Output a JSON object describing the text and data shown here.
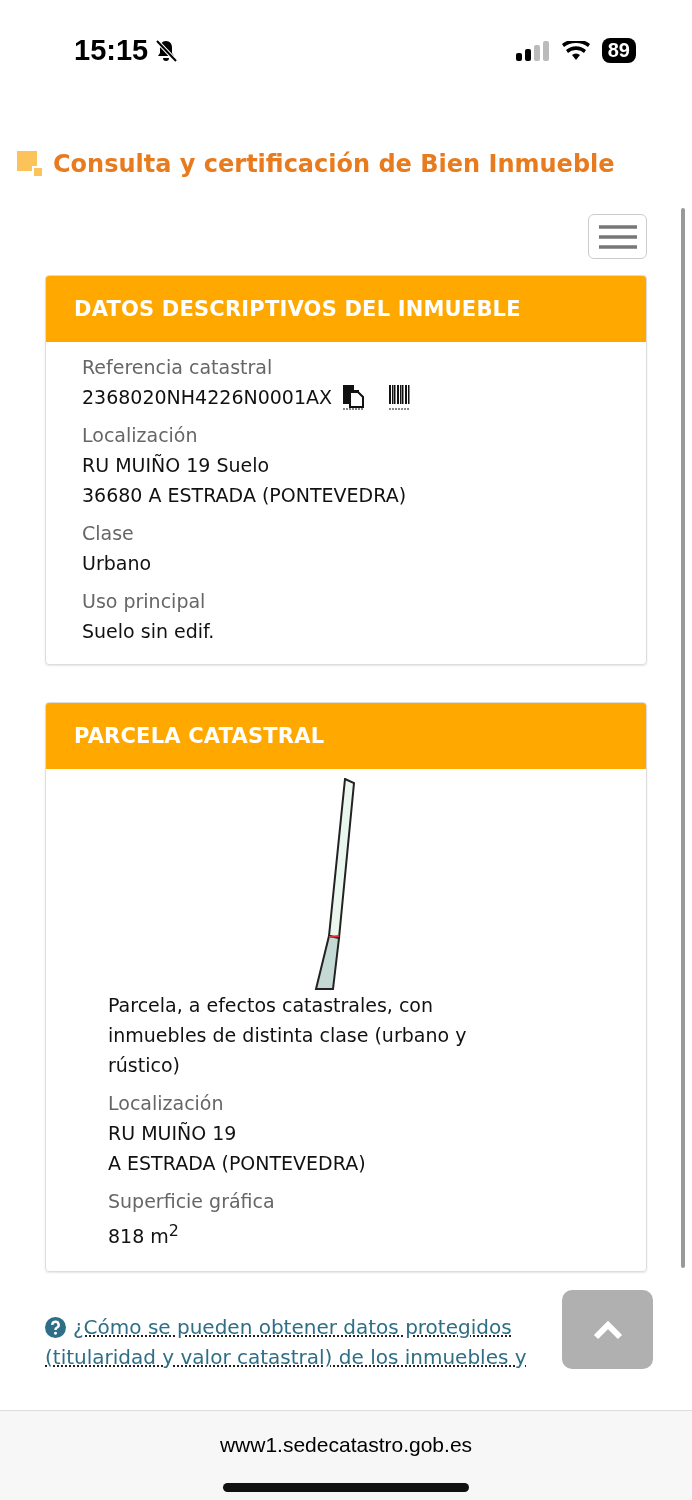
{
  "status_bar": {
    "time": "15:15",
    "battery": "89"
  },
  "page_title": "Consulta y certificación de Bien Inmueble",
  "cards": [
    {
      "title": "DATOS DESCRIPTIVOS DEL INMUEBLE",
      "kind": "fields",
      "fields": [
        {
          "label": "Referencia catastral",
          "lines": [
            "2368020NH4226N0001AX"
          ],
          "actions": true
        },
        {
          "label": "Localización",
          "lines": [
            "RU MUIÑO 19 Suelo",
            "36680 A ESTRADA (PONTEVEDRA)"
          ]
        },
        {
          "label": "Clase",
          "lines": [
            "Urbano"
          ]
        },
        {
          "label": "Uso principal",
          "lines": [
            "Suelo sin edif."
          ]
        }
      ]
    },
    {
      "title": "PARCELA CATASTRAL",
      "kind": "parcel",
      "description": "Parcela, a efectos catastrales, con inmuebles de distinta clase (urbano y rústico)",
      "fields": [
        {
          "label": "Localización",
          "lines": [
            "RU MUIÑO 19",
            "A ESTRADA (PONTEVEDRA)"
          ]
        },
        {
          "label": "Superficie gráfica",
          "lines": [
            "818 m$^{2}$"
          ]
        }
      ]
    }
  ],
  "help_link": "¿Cómo se pueden obtener datos protegidos (titularidad y valor catastral) de los inmuebles y",
  "address_bar": {
    "url": "www1.sedecatastro.gob.es"
  }
}
